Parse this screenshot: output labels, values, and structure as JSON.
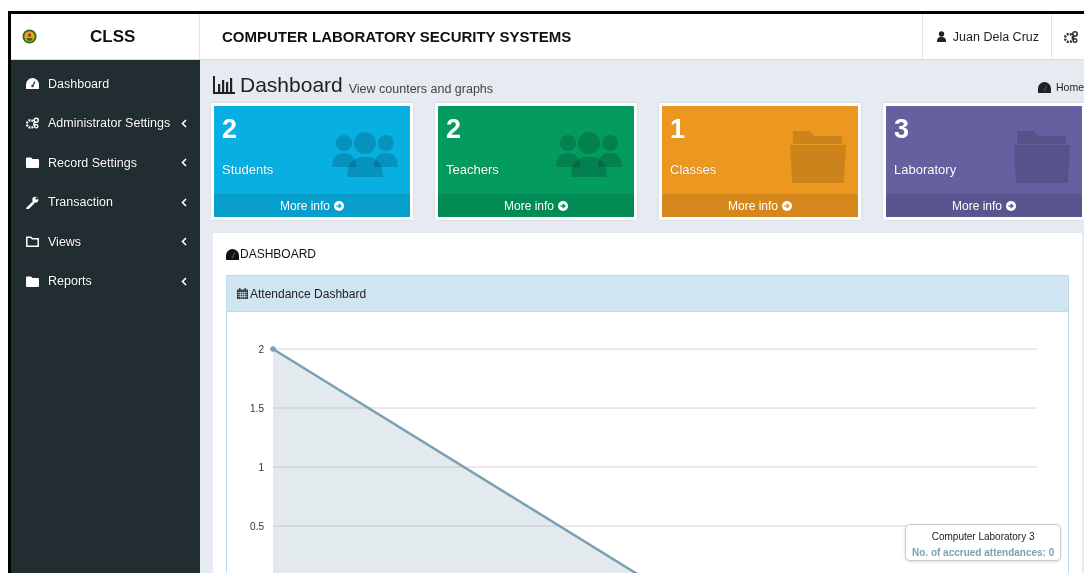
{
  "brand": {
    "title": "CLSS"
  },
  "header": {
    "title": "COMPUTER LABORATORY SECURITY SYSTEMS",
    "user": "Juan Dela Cruz"
  },
  "sidebar": {
    "items": [
      {
        "label": "Dashboard",
        "kind": "gauge",
        "expandable": false
      },
      {
        "label": "Administrator Settings",
        "kind": "gears",
        "expandable": true
      },
      {
        "label": "Record Settings",
        "kind": "folder",
        "expandable": true
      },
      {
        "label": "Transaction",
        "kind": "wrench",
        "expandable": true
      },
      {
        "label": "Views",
        "kind": "folder-outline",
        "expandable": true
      },
      {
        "label": "Reports",
        "kind": "folder",
        "expandable": true
      }
    ]
  },
  "page_header": {
    "title": "Dashboard",
    "subtitle": "View counters and graphs",
    "breadcrumb": "Home"
  },
  "info_boxes": [
    {
      "count": "2",
      "label": "Students",
      "link": "More info",
      "color": "#08b0e2",
      "kind": "people"
    },
    {
      "count": "2",
      "label": "Teachers",
      "link": "More info",
      "color": "#049b5f",
      "kind": "people"
    },
    {
      "count": "1",
      "label": "Classes",
      "link": "More info",
      "color": "#ec9720",
      "kind": "folder"
    },
    {
      "count": "3",
      "label": "Laboratory",
      "link": "More info",
      "color": "#665fa0",
      "kind": "folder"
    }
  ],
  "panel": {
    "title": "DASHBOARD",
    "chart_panel": {
      "title": "Attendance Dashbard",
      "chart_data": {
        "type": "area",
        "series": [
          {
            "color": "#7aa1b2",
            "values": [
              2,
              0,
              0
            ]
          }
        ],
        "ylim": [
          0,
          2
        ],
        "yticks": [
          0.5,
          1,
          1.5,
          2
        ],
        "grid": true
      },
      "tooltip": {
        "title": "Computer Laboratory 3",
        "text": "No. of accrued attendances: 0"
      }
    }
  }
}
